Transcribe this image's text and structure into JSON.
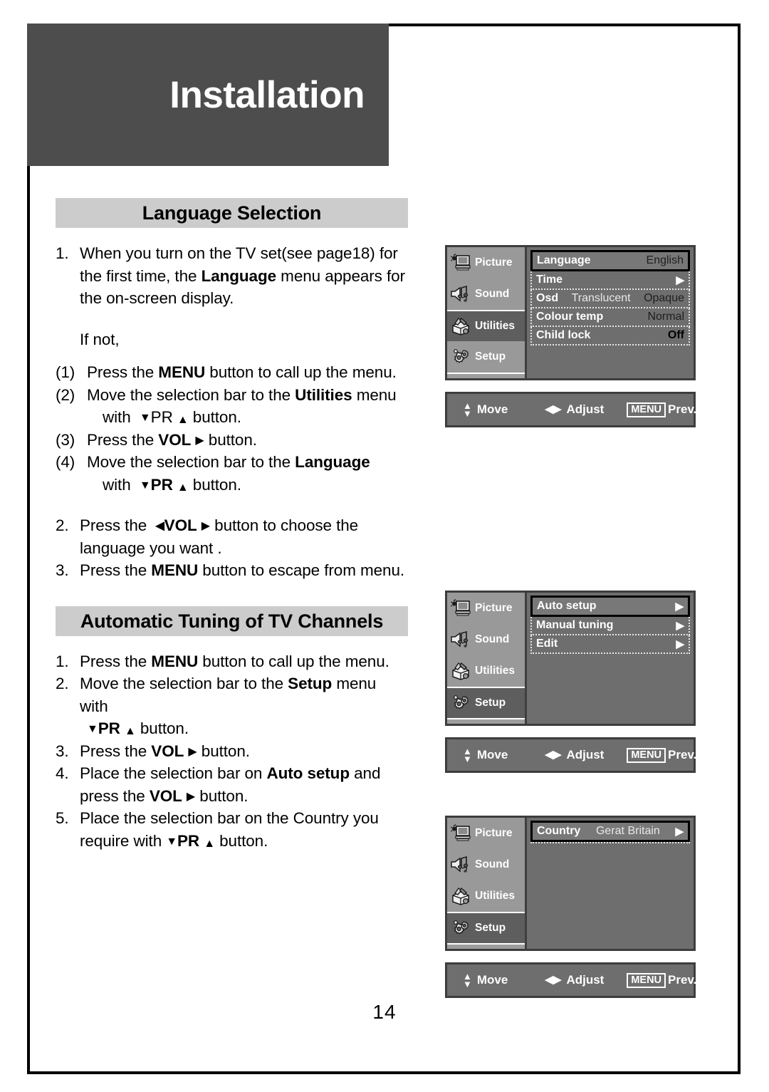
{
  "banner": {
    "title": "Installation"
  },
  "page_number": "14",
  "sections": [
    {
      "heading": "Language Selection",
      "items": [
        {
          "num": "1.",
          "lines": [
            "When you turn on the TV set(see page18) for",
            "the first time, the Language menu appears for",
            "the on-screen display."
          ]
        },
        {
          "text": "If not,"
        },
        {
          "num": "(1)",
          "text": "Press the MENU button to call up the menu."
        },
        {
          "num": "(2)",
          "line1": "Move the selection bar to the Utilities menu",
          "line2": "with  ▼PR ▲ button."
        },
        {
          "num": "(3)",
          "text": "Press the VOL ▶ button."
        },
        {
          "num": "(4)",
          "line1": "Move the selection bar to the Language",
          "line2": "with  ▼PR ▲ button."
        },
        {
          "num": "2.",
          "line1": "Press the  ◀VOL ▶ button to choose the",
          "line2": "language you want ."
        },
        {
          "num": "3.",
          "text": "Press the MENU button to escape from menu."
        }
      ]
    },
    {
      "heading": "Automatic Tuning of TV Channels",
      "items": [
        {
          "num": "1.",
          "text": "Press the MENU button to call up the menu."
        },
        {
          "num": "2.",
          "line1": "Move the selection bar to the Setup menu with",
          "line2": "▼PR ▲ button."
        },
        {
          "num": "3.",
          "text": "Press the VOL ▶ button."
        },
        {
          "num": "4.",
          "line1": "Place the selection bar on Auto setup and",
          "line2": "press the VOL ▶ button."
        },
        {
          "num": "5.",
          "line1": "Place the selection bar on the Country you",
          "line2": "require with ▼PR ▲ button."
        }
      ]
    }
  ],
  "osd_common": {
    "sidebar": [
      {
        "label": "Picture",
        "icon": "picture-icon"
      },
      {
        "label": "Sound",
        "icon": "sound-icon"
      },
      {
        "label": "Utilities",
        "icon": "utilities-icon"
      },
      {
        "label": "Setup",
        "icon": "setup-icon"
      }
    ],
    "bar": {
      "move": "Move",
      "adjust": "Adjust",
      "menu_key": "MENU",
      "prev": "Prev."
    }
  },
  "osd_panels": [
    {
      "selected_sidebar": "Utilities",
      "rows": [
        {
          "label": "Language",
          "value": "English"
        },
        {
          "label": "Time",
          "arrow": "▶"
        },
        {
          "label": "Osd",
          "mid": "Translucent",
          "value": "Opaque"
        },
        {
          "label": "Colour temp",
          "value": "Normal"
        },
        {
          "label": "Child lock",
          "value": "Off"
        }
      ]
    },
    {
      "selected_sidebar": "Setup",
      "rows": [
        {
          "label": "Auto setup",
          "arrow": "▶"
        },
        {
          "label": "Manual tuning",
          "arrow": "▶"
        },
        {
          "label": "Edit",
          "arrow": "▶"
        }
      ]
    },
    {
      "selected_sidebar": "Setup",
      "rows": [
        {
          "label": "Country",
          "mid": "Gerat Britain",
          "arrow": "▶"
        }
      ]
    }
  ],
  "colors": {
    "banner_bg": "#4d4d4d",
    "heading_bg": "#cccccc",
    "osd_bg": "#6e6e6e",
    "osd_sidebar_bg": "#999999",
    "osd_selected_bg": "#5e5e5e"
  }
}
